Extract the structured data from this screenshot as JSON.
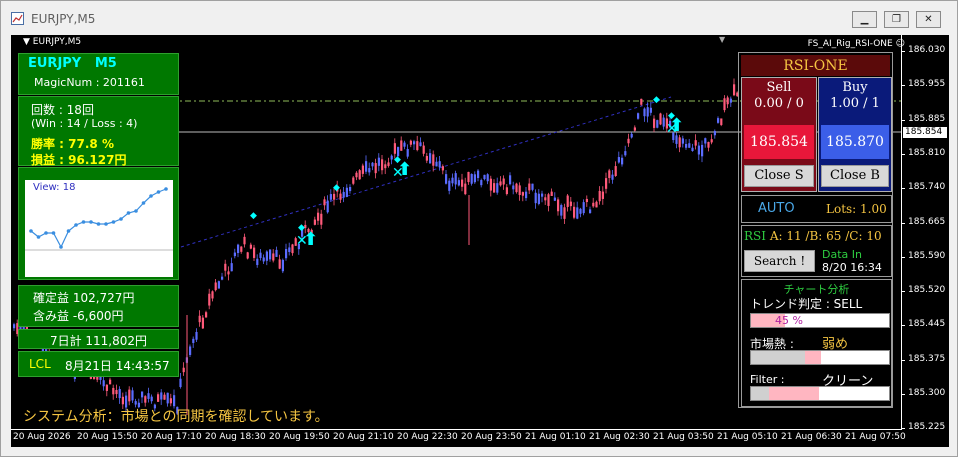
{
  "window": {
    "title": "EURJPY,M5"
  },
  "chart": {
    "symbol": "EURJPY,M5",
    "ea_name": "FS_AI_Rig_RSI-ONE",
    "current_price": "185.854",
    "y_ticks": [
      "186.030",
      "185.955",
      "185.885",
      "185.810",
      "185.740",
      "185.665",
      "185.590",
      "185.520",
      "185.445",
      "185.375",
      "185.300",
      "185.225"
    ],
    "x_ticks": [
      "20 Aug 2026",
      "20 Aug 15:50",
      "20 Aug 17:10",
      "20 Aug 18:30",
      "20 Aug 19:50",
      "20 Aug 21:10",
      "20 Aug 22:30",
      "20 Aug 23:50",
      "21 Aug 01:10",
      "21 Aug 02:30",
      "21 Aug 03:50",
      "21 Aug 05:10",
      "21 Aug 06:30",
      "21 Aug 07:50"
    ],
    "system_message": "システム分析：市場との同期を確認しています。"
  },
  "left_panel": {
    "pair": "EURJPY",
    "timeframe": "M5",
    "magic_label": "MagicNum : 201161",
    "trades_label": "回数 : 18回",
    "win_loss": "(Win : 14 /  Loss :  4)",
    "winrate": "勝率 : 77.8 %",
    "profit": "損益 : 96.127円",
    "view_label": "View: 18",
    "confirmed": "確定益 102,727円",
    "floating": "含み益 -6,600円",
    "week_total": "7日計 111,802円",
    "local_label": "LCL",
    "local_time": "8月21日 14:43:57"
  },
  "right_panel": {
    "title": "RSI-ONE",
    "sell_label": "Sell",
    "sell_lots": "0.00 / 0",
    "sell_price": "185.854",
    "buy_label": "Buy",
    "buy_lots": "1.00 / 1",
    "buy_price": "185.870",
    "close_sell": "Close S",
    "close_buy": "Close B",
    "auto_label": "AUTO",
    "lots_label": "Lots: 1.00",
    "rsi_prefix": "RSI",
    "rsi_values": "A: 11 /B: 65 /C: 10",
    "search_button": "Search !",
    "data_in_label": "Data In",
    "data_in_time": "8/20 16:34",
    "analysis_title": "チャート分析",
    "trend_label": "トレンド判定 : SELL",
    "trend_percent": "45 %",
    "trend_level": 0.45,
    "heat_label": "市場熱 :",
    "heat_value": "弱め",
    "filter_label": "Filter :",
    "filter_value": "クリーン"
  },
  "equity_curve": [
    46,
    40,
    44,
    44,
    30,
    46,
    52,
    55,
    55,
    53,
    53,
    55,
    58,
    64,
    66,
    74,
    81,
    85,
    88
  ],
  "colors": {
    "panel_green": "#007800",
    "sell_red": "#e8173a",
    "buy_blue": "#3b5ee8",
    "bull": "#5b6cff",
    "bear": "#ff5a7a",
    "accent_cyan": "#00ffff"
  }
}
